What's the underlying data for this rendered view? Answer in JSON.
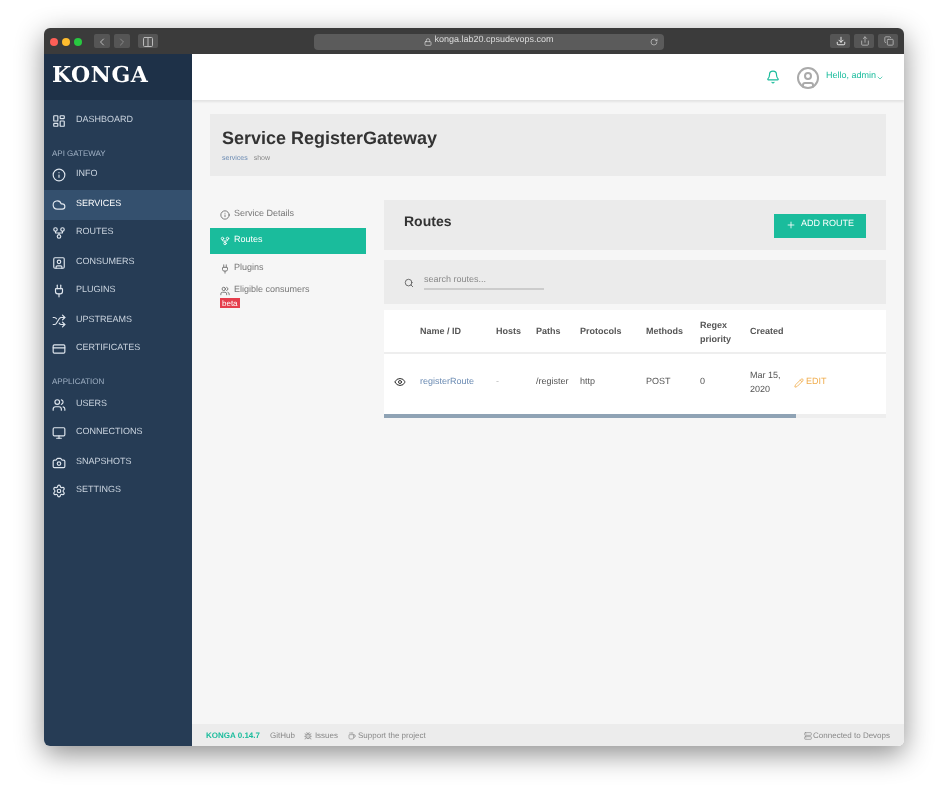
{
  "browser": {
    "url": "konga.lab20.cpsudevops.com"
  },
  "sidebar": {
    "logo": "KONGA",
    "entries": [
      {
        "kind": "item",
        "label": "DASHBOARD",
        "selected": false
      },
      {
        "kind": "heading",
        "label": "API GATEWAY"
      },
      {
        "kind": "item",
        "label": "INFO",
        "selected": false
      },
      {
        "kind": "item",
        "label": "SERVICES",
        "selected": true
      },
      {
        "kind": "item",
        "label": "ROUTES",
        "selected": false
      },
      {
        "kind": "item",
        "label": "CONSUMERS",
        "selected": false
      },
      {
        "kind": "item",
        "label": "PLUGINS",
        "selected": false
      },
      {
        "kind": "item",
        "label": "UPSTREAMS",
        "selected": false
      },
      {
        "kind": "item",
        "label": "CERTIFICATES",
        "selected": false
      },
      {
        "kind": "heading",
        "label": "APPLICATION"
      },
      {
        "kind": "item",
        "label": "USERS",
        "selected": false
      },
      {
        "kind": "item",
        "label": "CONNECTIONS",
        "selected": false
      },
      {
        "kind": "item",
        "label": "SNAPSHOTS",
        "selected": false
      },
      {
        "kind": "item",
        "label": "SETTINGS",
        "selected": false
      }
    ]
  },
  "topbar": {
    "greeting": "Hello, admin"
  },
  "header": {
    "title": "Service RegisterGateway",
    "breadcrumb": [
      "services",
      "show"
    ]
  },
  "service_nav": [
    {
      "label": "Service Details",
      "selected": false
    },
    {
      "label": "Routes",
      "selected": true
    },
    {
      "label": "Plugins",
      "selected": false
    },
    {
      "label": "Eligible consumers",
      "selected": false,
      "badge": "beta"
    }
  ],
  "routes": {
    "title": "Routes",
    "add_button": "ADD ROUTE",
    "search": {
      "placeholder": "search routes..."
    },
    "table": {
      "columns": [
        "Name / ID",
        "Hosts",
        "Paths",
        "Protocols",
        "Methods",
        "Regex priority",
        "Created"
      ],
      "rows": [
        {
          "cells": [
            "registerRoute",
            "-",
            "/register",
            "http",
            "POST",
            "0",
            "Mar 15, 2020"
          ],
          "action": "EDIT"
        }
      ]
    }
  },
  "footer": {
    "version": "KONGA 0.14.7",
    "links": [
      "GitHub",
      "Issues",
      "Support the project"
    ],
    "connection": "Connected to Devops"
  }
}
